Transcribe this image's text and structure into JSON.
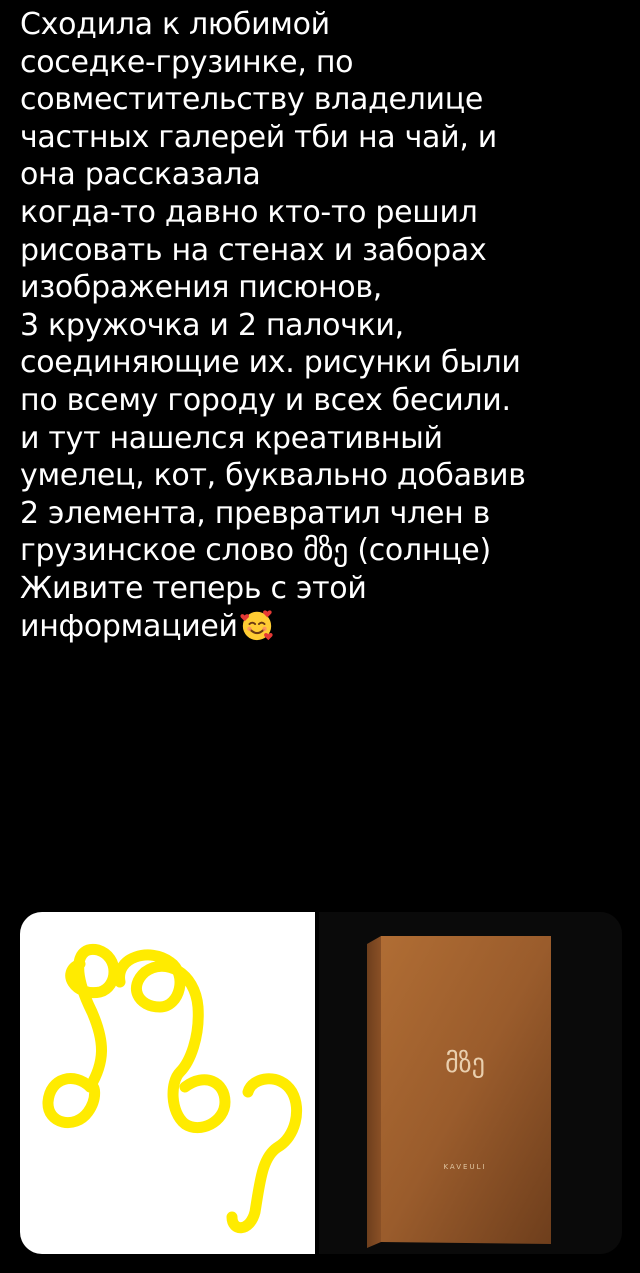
{
  "post": {
    "lines": [
      "Сходила к любимой",
      "соседке-грузинке, по",
      "совместительству владелице",
      "частных галерей тби на чай, и",
      "она рассказала",
      "когда-то давно кто-то решил",
      "рисовать на стенах и заборах",
      "изображения писюнов,",
      "3 кружочка и 2 палочки,",
      "соединяющие их. рисунки были",
      "по всему городу и всех бесили.",
      "и тут нашелся креативный",
      "умелец, кот, буквально добавив",
      "2 элемента, превратил член в",
      "грузинское слово მზე (солнце)",
      "Живите теперь с этой",
      "информацией"
    ],
    "emoji": "smiling-face-with-hearts"
  },
  "media": {
    "left_image": {
      "description_icon": "yellow-georgian-scribble",
      "stroke_color": "#ffeb00"
    },
    "right_image": {
      "box_logo": "მზე",
      "box_brand": "KAVEULI",
      "box_color": "#9a5c2c"
    }
  }
}
